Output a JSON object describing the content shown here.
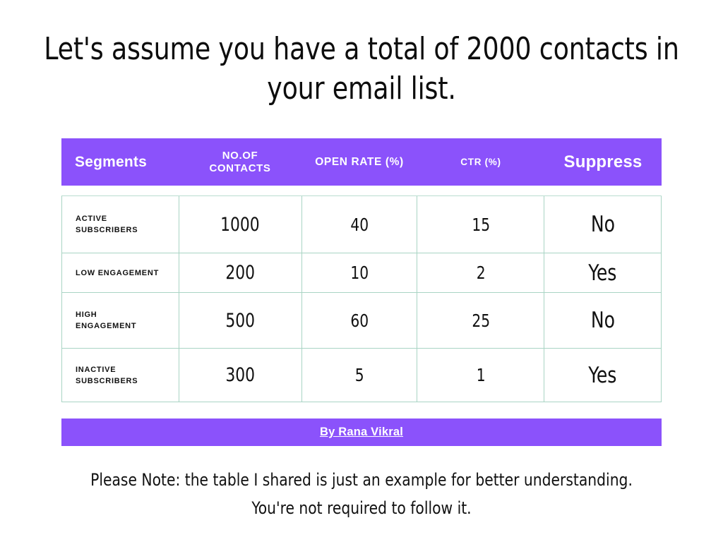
{
  "slide": {
    "headline": "Let's assume you have a total of 2000 contacts in\nyour email list.",
    "footnote": "Please Note: the table I shared is just an example for better understanding.\nYou're not required to follow it.",
    "credit": "By Rana Vikral",
    "accent_color": "#8b52fb",
    "border_color": "#a9d4c4",
    "text_color": "#111111",
    "background_color": "#ffffff"
  },
  "table": {
    "headers": {
      "segments": "Segments",
      "contacts": "NO.OF\nCONTACTS",
      "open_rate": "OPEN RATE (%)",
      "ctr": "CTR (%)",
      "suppress": "Suppress"
    },
    "rows": [
      {
        "segment": "ACTIVE\nSUBSCRIBERS",
        "contacts": "1000",
        "open_rate": "40",
        "ctr": "15",
        "suppress": "No"
      },
      {
        "segment": "LOW ENGAGEMENT",
        "contacts": "200",
        "open_rate": "10",
        "ctr": "2",
        "suppress": "Yes"
      },
      {
        "segment": "HIGH\nENGAGEMENT",
        "contacts": "500",
        "open_rate": "60",
        "ctr": "25",
        "suppress": "No"
      },
      {
        "segment": "INACTIVE\nSUBSCRIBERS",
        "contacts": "300",
        "open_rate": "5",
        "ctr": "1",
        "suppress": "Yes"
      }
    ]
  },
  "chart_data": {
    "type": "table",
    "title": "Let's assume you have a total of 2000 contacts in your email list.",
    "columns": [
      "Segments",
      "NO.OF CONTACTS",
      "OPEN RATE (%)",
      "CTR (%)",
      "Suppress"
    ],
    "rows": [
      [
        "ACTIVE SUBSCRIBERS",
        1000,
        40,
        15,
        "No"
      ],
      [
        "LOW ENGAGEMENT",
        200,
        10,
        2,
        "Yes"
      ],
      [
        "HIGH ENGAGEMENT",
        500,
        60,
        25,
        "No"
      ],
      [
        "INACTIVE SUBSCRIBERS",
        300,
        5,
        1,
        "Yes"
      ]
    ],
    "total_contacts": 2000,
    "annotation": "Please Note: the table I shared is just an example for better understanding. You're not required to follow it."
  }
}
